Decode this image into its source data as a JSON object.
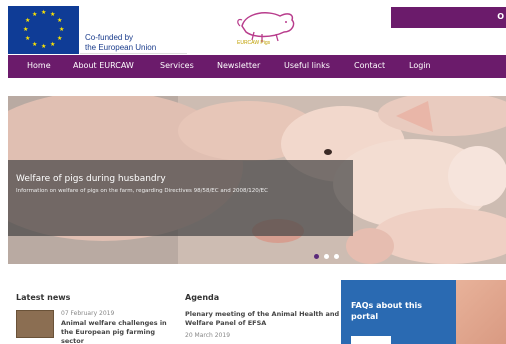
{
  "header": {
    "cofunded_line1": "Co-funded by",
    "cofunded_line2": "the European Union",
    "logo_caption": "EURCAW Pigs",
    "topbar_label": "O"
  },
  "nav": {
    "items": [
      {
        "label": "Home"
      },
      {
        "label": "About EURCAW"
      },
      {
        "label": "Services"
      },
      {
        "label": "Newsletter"
      },
      {
        "label": "Useful links"
      },
      {
        "label": "Contact"
      },
      {
        "label": "Login"
      }
    ]
  },
  "hero": {
    "title": "Welfare of pigs during husbandry",
    "description": "Information on welfare of pigs on the farm, regarding Directives 98/58/EC and 2008/120/EC",
    "slide_count": 3,
    "active_slide": 1
  },
  "latest_news": {
    "heading": "Latest news",
    "items": [
      {
        "date": "07 February 2019",
        "title": "Animal welfare challenges in the European pig farming sector"
      }
    ]
  },
  "agenda": {
    "heading": "Agenda",
    "items": [
      {
        "title": "Plenary meeting of the Animal Health and Welfare Panel of EFSA",
        "date": "20 March 2019"
      }
    ]
  },
  "faq": {
    "heading": "FAQs about this portal"
  },
  "colors": {
    "purple": "#6b1b6b",
    "eu_blue": "#0f3c96",
    "faq_blue": "#2a6ab2"
  }
}
